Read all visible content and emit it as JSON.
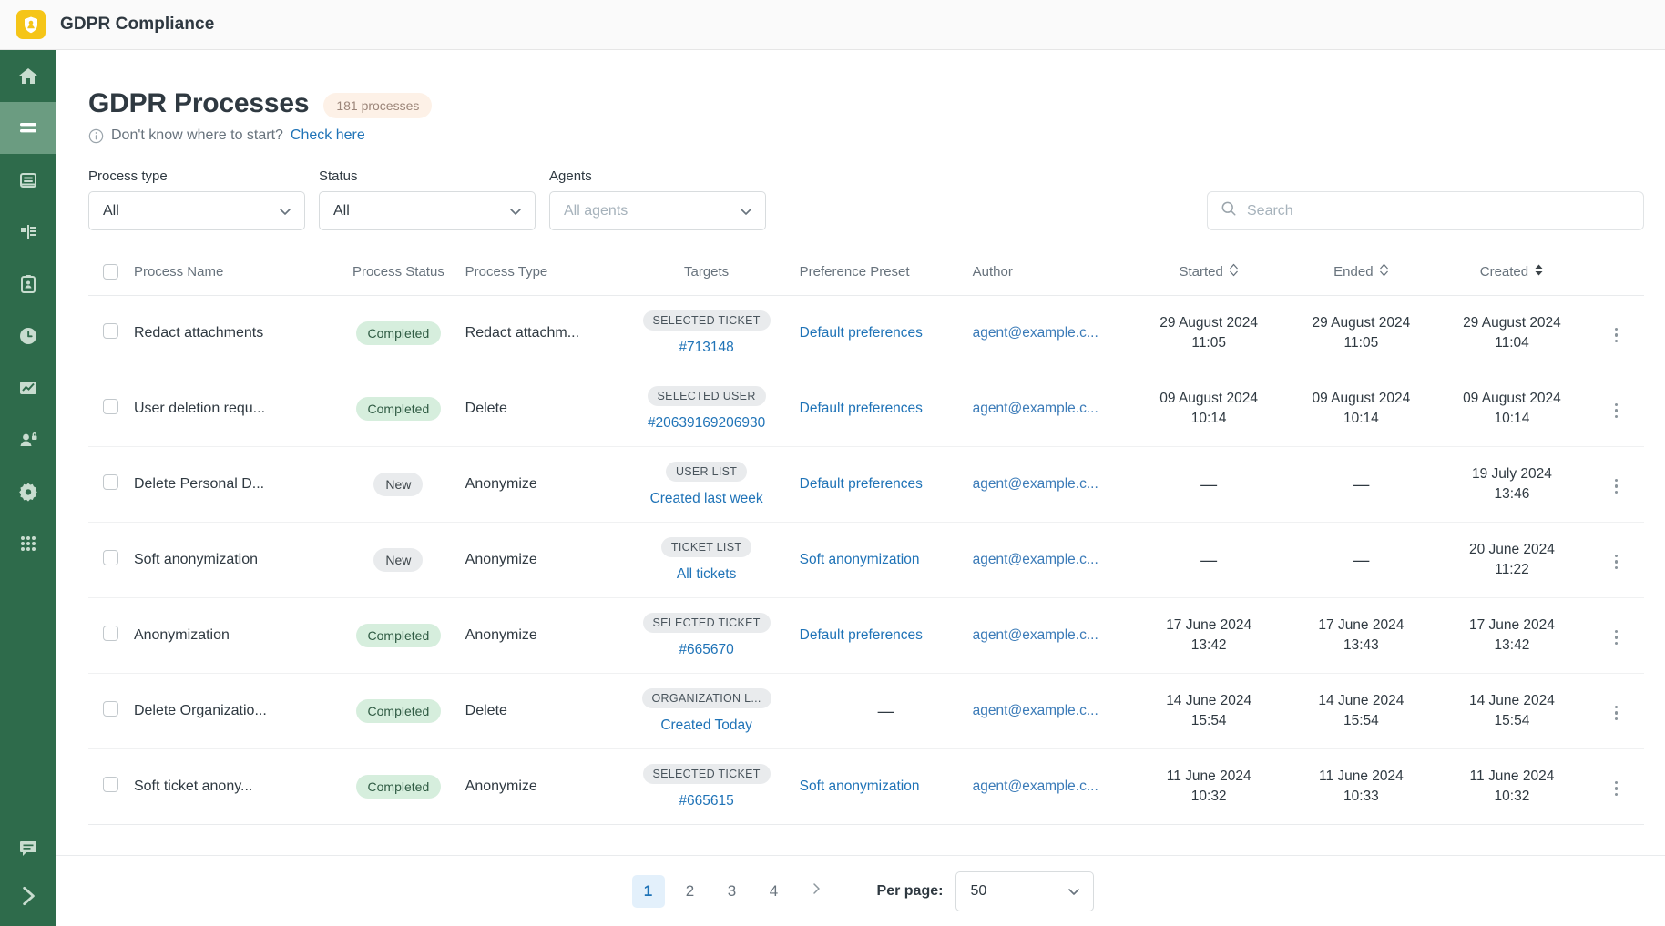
{
  "app": {
    "title": "GDPR Compliance",
    "logo_icon": "shield-person-icon",
    "logo_color": "#f5c518"
  },
  "sidebar": {
    "items": [
      {
        "icon": "home-icon",
        "name": "home",
        "active": false
      },
      {
        "icon": "processes-icon",
        "name": "processes",
        "active": true
      },
      {
        "icon": "database-icon",
        "name": "data-sources",
        "active": false
      },
      {
        "icon": "mapping-icon",
        "name": "data-mapping",
        "active": false
      },
      {
        "icon": "clipboard-person-icon",
        "name": "requests",
        "active": false
      },
      {
        "icon": "clock-icon",
        "name": "retention",
        "active": false
      },
      {
        "icon": "chart-icon",
        "name": "reports",
        "active": false
      },
      {
        "icon": "user-lock-icon",
        "name": "consent",
        "active": false
      },
      {
        "icon": "gear-icon",
        "name": "settings",
        "active": false
      },
      {
        "icon": "apps-grid-icon",
        "name": "apps",
        "active": false
      }
    ],
    "bottom_items": [
      {
        "icon": "chat-icon",
        "name": "support"
      },
      {
        "icon": "chevron-right-icon",
        "name": "expand-sidebar"
      }
    ]
  },
  "header": {
    "page_title": "GDPR Processes",
    "count_badge": "181 processes",
    "hint_icon": "info-icon",
    "hint_text": "Don't know where to start?",
    "hint_link": "Check here"
  },
  "filters": {
    "process_type": {
      "label": "Process type",
      "value": "All"
    },
    "status": {
      "label": "Status",
      "value": "All"
    },
    "agents": {
      "label": "Agents",
      "placeholder": "All agents",
      "value": ""
    }
  },
  "search": {
    "placeholder": "Search",
    "value": "",
    "icon": "search-icon"
  },
  "table": {
    "columns": [
      {
        "key": "check",
        "label": ""
      },
      {
        "key": "name",
        "label": "Process Name"
      },
      {
        "key": "pstatus",
        "label": "Process Status"
      },
      {
        "key": "ptype",
        "label": "Process Type"
      },
      {
        "key": "targets",
        "label": "Targets"
      },
      {
        "key": "preference",
        "label": "Preference Preset"
      },
      {
        "key": "author",
        "label": "Author"
      },
      {
        "key": "started",
        "label": "Started",
        "sort": "none"
      },
      {
        "key": "ended",
        "label": "Ended",
        "sort": "none"
      },
      {
        "key": "created",
        "label": "Created",
        "sort": "active"
      },
      {
        "key": "menu",
        "label": ""
      }
    ],
    "rows": [
      {
        "name": "Redact attachments",
        "status": "Completed",
        "status_kind": "completed",
        "type": "Redact attachm...",
        "target_tag": "SELECTED TICKET",
        "target_sub": "#713148",
        "preference": "Default preferences",
        "author": "agent@example.c...",
        "started_date": "29 August 2024",
        "started_time": "11:05",
        "ended_date": "29 August 2024",
        "ended_time": "11:05",
        "created_date": "29 August 2024",
        "created_time": "11:04"
      },
      {
        "name": "User deletion requ...",
        "status": "Completed",
        "status_kind": "completed",
        "type": "Delete",
        "target_tag": "SELECTED USER",
        "target_sub": "#20639169206930",
        "preference": "Default preferences",
        "author": "agent@example.c...",
        "started_date": "09 August 2024",
        "started_time": "10:14",
        "ended_date": "09 August 2024",
        "ended_time": "10:14",
        "created_date": "09 August 2024",
        "created_time": "10:14"
      },
      {
        "name": "Delete Personal D...",
        "status": "New",
        "status_kind": "new",
        "type": "Anonymize",
        "target_tag": "USER LIST",
        "target_sub": "Created last week",
        "preference": "Default preferences",
        "author": "agent@example.c...",
        "started_date": "—",
        "started_time": "",
        "ended_date": "—",
        "ended_time": "",
        "created_date": "19 July 2024",
        "created_time": "13:46"
      },
      {
        "name": "Soft anonymization",
        "status": "New",
        "status_kind": "new",
        "type": "Anonymize",
        "target_tag": "TICKET LIST",
        "target_sub": "All tickets",
        "preference": "Soft anonymization",
        "author": "agent@example.c...",
        "started_date": "—",
        "started_time": "",
        "ended_date": "—",
        "ended_time": "",
        "created_date": "20 June 2024",
        "created_time": "11:22"
      },
      {
        "name": "Anonymization",
        "status": "Completed",
        "status_kind": "completed",
        "type": "Anonymize",
        "target_tag": "SELECTED TICKET",
        "target_sub": "#665670",
        "preference": "Default preferences",
        "author": "agent@example.c...",
        "started_date": "17 June 2024",
        "started_time": "13:42",
        "ended_date": "17 June 2024",
        "ended_time": "13:43",
        "created_date": "17 June 2024",
        "created_time": "13:42"
      },
      {
        "name": "Delete Organizatio...",
        "status": "Completed",
        "status_kind": "completed",
        "type": "Delete",
        "target_tag": "ORGANIZATION L...",
        "target_sub": "Created Today",
        "preference": "—",
        "author": "agent@example.c...",
        "started_date": "14 June 2024",
        "started_time": "15:54",
        "ended_date": "14 June 2024",
        "ended_time": "15:54",
        "created_date": "14 June 2024",
        "created_time": "15:54"
      },
      {
        "name": "Soft ticket anony...",
        "status": "Completed",
        "status_kind": "completed",
        "type": "Anonymize",
        "target_tag": "SELECTED TICKET",
        "target_sub": "#665615",
        "preference": "Soft anonymization",
        "author": "agent@example.c...",
        "started_date": "11 June 2024",
        "started_time": "10:32",
        "ended_date": "11 June 2024",
        "ended_time": "10:33",
        "created_date": "11 June 2024",
        "created_time": "10:32"
      }
    ]
  },
  "pagination": {
    "pages": [
      "1",
      "2",
      "3",
      "4"
    ],
    "current": "1",
    "next_icon": "chevron-right-icon",
    "per_page_label": "Per page:",
    "per_page_value": "50"
  },
  "colors": {
    "rail": "#2e6b4b",
    "rail_active": "#6b9c81",
    "brand_yellow": "#f5c518",
    "link": "#1f73b7",
    "badge_bg": "#fdf1e7",
    "pill_completed_bg": "#d6eedd",
    "pill_new_bg": "#e9ebed"
  }
}
